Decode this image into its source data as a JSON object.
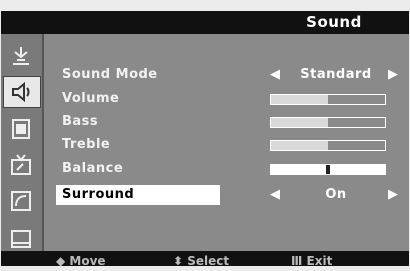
{
  "header": {
    "title": "Sound"
  },
  "sidebar": {
    "items": [
      {
        "icon": "antenna-icon"
      },
      {
        "icon": "sound-icon",
        "active": true
      },
      {
        "icon": "channel-icon"
      },
      {
        "icon": "tv-setup-icon"
      },
      {
        "icon": "input-icon"
      },
      {
        "icon": "picture-icon"
      }
    ]
  },
  "menu": {
    "sound_mode": {
      "label": "Sound Mode",
      "value": "Standard",
      "left_arrow": "◀",
      "right_arrow": "▶"
    },
    "volume": {
      "label": "Volume",
      "level": 0.5
    },
    "bass": {
      "label": "Bass",
      "level": 0.5
    },
    "treble": {
      "label": "Treble",
      "level": 0.5
    },
    "balance": {
      "label": "Balance",
      "level": 0.5
    },
    "surround": {
      "label": "Surround",
      "value": "On",
      "left_arrow": "◀",
      "right_arrow": "▶"
    }
  },
  "footer": {
    "move": "◆ Move",
    "select": "⬍ Select",
    "exit": "Ⅲ Exit"
  },
  "colors": {
    "background": "#8a8a8a",
    "bar_fill": "#d9d9d9",
    "header": "#111111",
    "selected": "#ffffff"
  }
}
